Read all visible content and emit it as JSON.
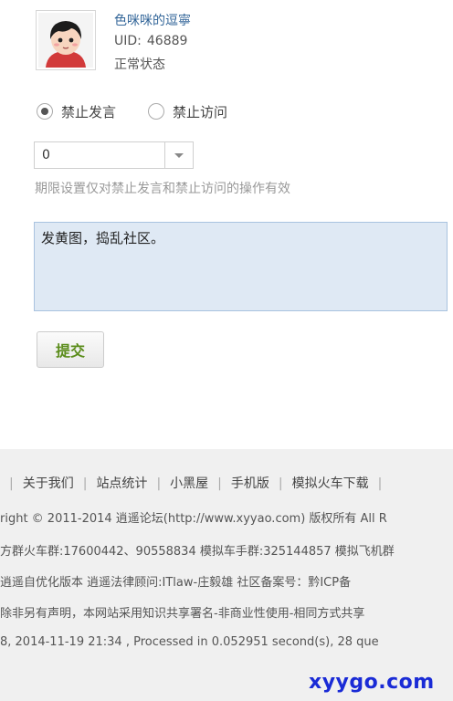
{
  "user": {
    "name": "色咪咪的逗寧",
    "uid_label": "UID:",
    "uid_value": "46889",
    "status": "正常状态"
  },
  "options": {
    "ban_post_label": "禁止发言",
    "ban_post_checked": true,
    "ban_visit_label": "禁止访问",
    "ban_visit_checked": false
  },
  "duration": {
    "selected": "0",
    "hint": "期限设置仅对禁止发言和禁止访问的操作有效"
  },
  "reason": {
    "value": "发黄图，捣乱社区。"
  },
  "submit_label": "提交",
  "footer": {
    "links": [
      "关于我们",
      "站点统计",
      "小黑屋",
      "手机版",
      "模拟火车下载"
    ],
    "copyright": "right © 2011-2014 逍遥论坛(http://www.xyyao.com) 版权所有 All R",
    "groups": "方群火车群:17600442、90558834  模拟车手群:325144857  模拟飞机群",
    "legal": "逍遥自优化版本   逍遥法律顾问:ITlaw-庄毅雄 社区备案号：黔ICP备",
    "license": "除非另有声明，本网站采用知识共享署名-非商业性使用-相同方式共享",
    "processed": "8, 2014-11-19 21:34 , Processed in 0.052951 second(s), 28 que"
  },
  "watermark": "xyygo.com",
  "colors": {
    "link_blue": "#336699",
    "submit_green": "#5a8c1a",
    "textarea_bg": "#dfe9f4",
    "footer_bg": "#f0f0f0",
    "watermark_blue": "#1a2bd6"
  }
}
